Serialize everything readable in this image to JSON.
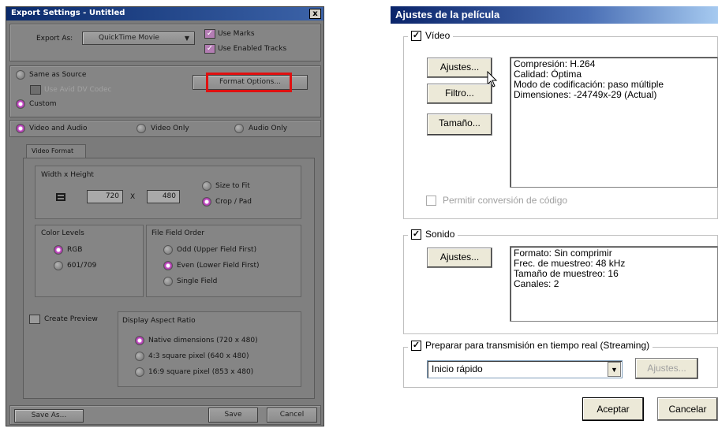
{
  "avid": {
    "title": "Export Settings - Untitled",
    "close": "x",
    "export_as_label": "Export As:",
    "export_as_value": "QuickTime Movie",
    "use_marks": "Use Marks",
    "use_enabled_tracks": "Use Enabled Tracks",
    "same_as_source": "Same as Source",
    "use_avid_dv_codec": "Use Avid DV Codec",
    "custom": "Custom",
    "format_options": "Format Options...",
    "video_and_audio": "Video and Audio",
    "video_only": "Video Only",
    "audio_only": "Audio Only",
    "tab_video_format": "Video Format",
    "width_height_label": "Width x Height",
    "width_value": "720",
    "x_sep": "X",
    "height_value": "480",
    "size_to_fit": "Size to Fit",
    "crop_pad": "Crop / Pad",
    "color_levels": "Color Levels",
    "rgb": "RGB",
    "r601_709": "601/709",
    "file_field_order": "File Field Order",
    "odd": "Odd (Upper Field First)",
    "even": "Even (Lower Field First)",
    "single_field": "Single Field",
    "create_preview": "Create Preview",
    "display_aspect_ratio": "Display Aspect Ratio",
    "native_dimensions": "Native dimensions  (720 x 480)",
    "square_43": "4:3 square pixel  (640 x 480)",
    "square_169": "16:9 square pixel  (853 x 480)",
    "save_as": "Save As...",
    "save": "Save",
    "cancel": "Cancel",
    "highlight_color": "#e01010",
    "accent_color": "#c84ec8"
  },
  "qt": {
    "title": "Ajustes de la película",
    "video_label": "Vídeo",
    "ajustes": "Ajustes...",
    "filtro": "Filtro...",
    "tamano": "Tamaño...",
    "video_info": [
      "Compresión: H.264",
      "Calidad: Óptima",
      "Modo de codificación: paso múltiple",
      "Dimensiones: -24749x-29 (Actual)"
    ],
    "permitir": "Permitir conversión de código",
    "sonido_label": "Sonido",
    "ajustes_sonido": "Ajustes...",
    "sound_info": [
      "Formato: Sin comprimir",
      "Frec. de muestreo: 48 kHz",
      "Tamaño de muestreo: 16",
      "Canales: 2"
    ],
    "streaming_label": "Preparar para transmisión en tiempo real (Streaming)",
    "streaming_value": "Inicio rápido",
    "ajustes_streaming": "Ajustes...",
    "aceptar": "Aceptar",
    "cancelar": "Cancelar",
    "check_mark": "✓"
  }
}
